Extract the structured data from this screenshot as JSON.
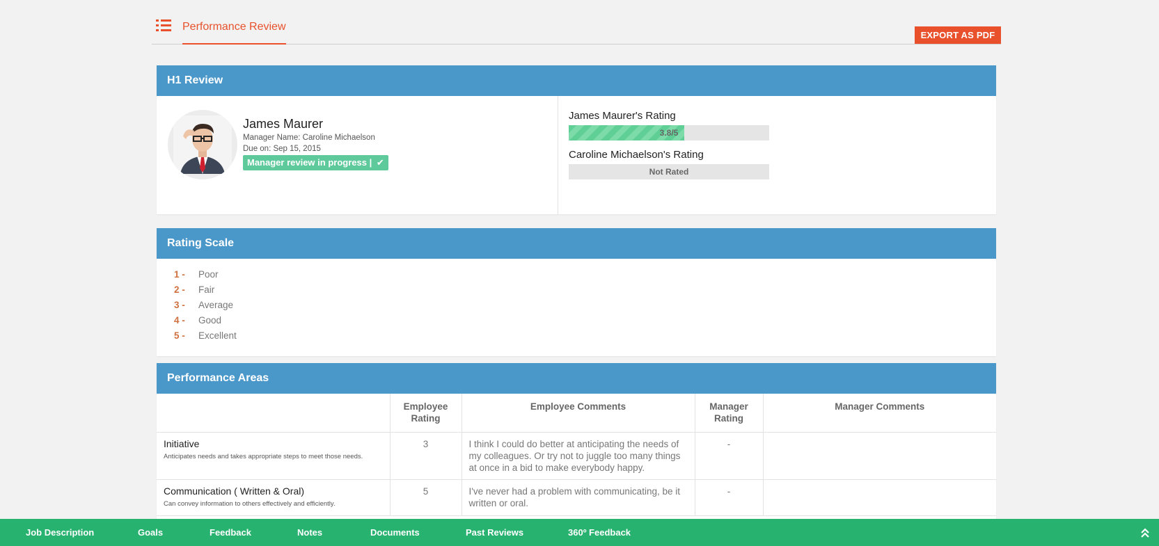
{
  "header": {
    "tab_label": "Performance Review",
    "export_label": "EXPORT AS PDF",
    "menu_icon": "list-icon",
    "accent_color": "#e8512c"
  },
  "review": {
    "title": "H1 Review",
    "employee_name": "James Maurer",
    "manager_line": "Manager Name: Caroline Michaelson",
    "due_line": "Due on: Sep 15, 2015",
    "status": "Manager review in progress |",
    "status_icon": "check-icon",
    "employee_rating_title": "James Maurer's Rating",
    "employee_rating_text": "3.8/5",
    "employee_rating_value": 3.8,
    "employee_rating_max": 5,
    "manager_rating_title": "Caroline Michaelson's Rating",
    "manager_rating_text": "Not Rated"
  },
  "scale": {
    "title": "Rating Scale",
    "items": [
      {
        "num": "1 -",
        "label": "Poor"
      },
      {
        "num": "2 -",
        "label": "Fair"
      },
      {
        "num": "3 -",
        "label": "Average"
      },
      {
        "num": "4 -",
        "label": "Good"
      },
      {
        "num": "5 -",
        "label": "Excellent"
      }
    ]
  },
  "areas": {
    "title": "Performance Areas",
    "columns": [
      "",
      "Employee Rating",
      "Employee Comments",
      "Manager Rating",
      "Manager Comments"
    ],
    "rows": [
      {
        "title": "Initiative",
        "desc": "Anticipates needs and takes appropriate steps to meet those needs.",
        "employee_rating": "3",
        "employee_comment": "I think I could do better at anticipating the needs of my colleagues. Or try not to juggle too many things at once in a bid to make everybody happy.",
        "manager_rating": "-",
        "manager_comment": ""
      },
      {
        "title": "Communication ( Written & Oral)",
        "desc": "Can convey information to others effectively and efficiently.",
        "employee_rating": "5",
        "employee_comment": "I've never had a problem with communicating, be it written or oral.",
        "manager_rating": "-",
        "manager_comment": ""
      }
    ]
  },
  "footer": {
    "items": [
      "Job Description",
      "Goals",
      "Feedback",
      "Notes",
      "Documents",
      "Past Reviews",
      "360º Feedback"
    ],
    "up_icon": "double-chevron-up-icon",
    "color": "#27b26f"
  }
}
